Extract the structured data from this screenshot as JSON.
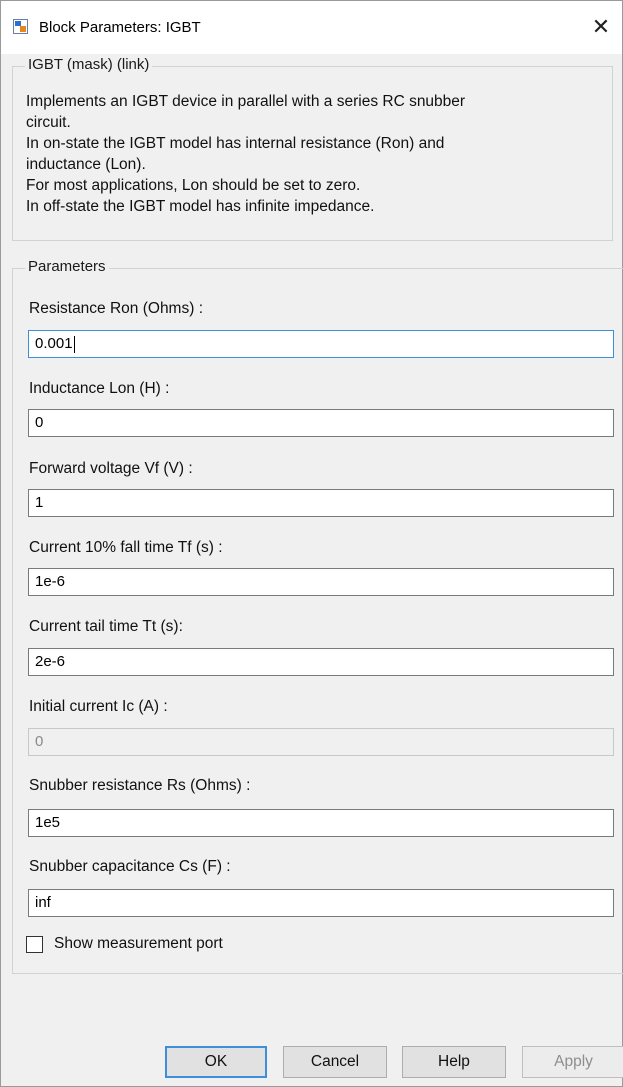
{
  "window": {
    "title": "Block Parameters: IGBT",
    "close_glyph": "✕"
  },
  "header_group": {
    "label": "IGBT (mask) (link)",
    "description": [
      "Implements an IGBT device  in parallel with a series RC snubber",
      "circuit.",
      "In on-state the IGBT model has internal resistance (Ron) and",
      "inductance (Lon).",
      "For most applications, Lon should be set to zero.",
      "In off-state the IGBT model has infinite impedance."
    ]
  },
  "parameters": {
    "label": "Parameters",
    "fields": [
      {
        "label": "Resistance Ron (Ohms) :",
        "value": "0.001"
      },
      {
        "label": "Inductance Lon (H) :",
        "value": "0"
      },
      {
        "label": "Forward voltage Vf (V) :",
        "value": "1"
      },
      {
        "label": "Current 10% fall time Tf (s) :",
        "value": "1e-6"
      },
      {
        "label": "Current tail time Tt (s):",
        "value": "2e-6"
      },
      {
        "label": "Initial current Ic (A) :",
        "value": "0"
      },
      {
        "label": "Snubber resistance Rs (Ohms) :",
        "value": "1e5"
      },
      {
        "label": "Snubber capacitance Cs (F) :",
        "value": "inf"
      }
    ],
    "show_measurement": {
      "label": "Show measurement port",
      "checked": false
    }
  },
  "buttons": {
    "ok": "OK",
    "cancel": "Cancel",
    "help": "Help",
    "apply": "Apply"
  },
  "colors": {
    "focus_border": "#3c8fd8",
    "disabled_text": "#8a8a8a"
  }
}
